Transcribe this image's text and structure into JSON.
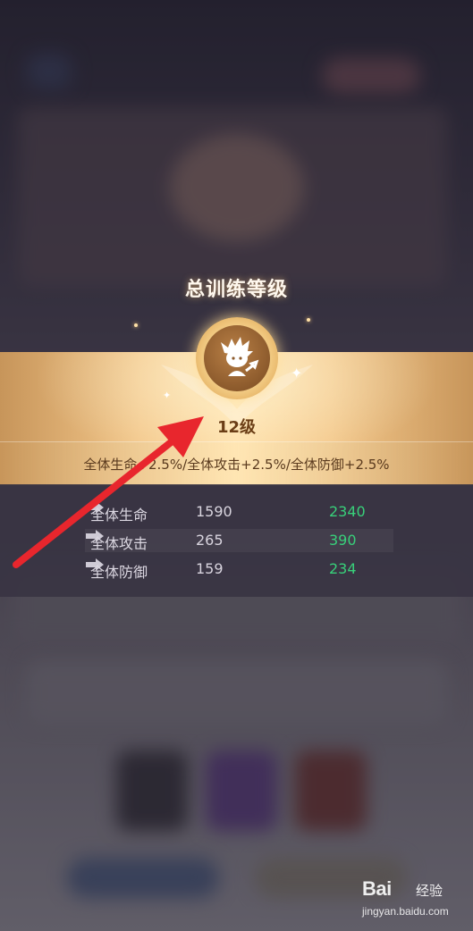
{
  "popup": {
    "title": "总训练等级",
    "level": "12级",
    "bonus": "全体生命+2.5%/全体攻击+2.5%/全体防御+2.5%",
    "emblem_icon": "hero-chibi-icon",
    "stats": [
      {
        "label": "全体生命",
        "old": "1590",
        "new": "2340"
      },
      {
        "label": "全体攻击",
        "old": "265",
        "new": "390"
      },
      {
        "label": "全体防御",
        "old": "159",
        "new": "234"
      }
    ],
    "colors": {
      "increase": "#38d07a",
      "level_text": "#6b3e16",
      "banner": "#f4c88b"
    }
  },
  "annotation": {
    "arrow_color": "#e8262d"
  },
  "watermark": {
    "brand": "Bai",
    "brand_suffix": "经验",
    "url": "jingyan.baidu.com"
  }
}
